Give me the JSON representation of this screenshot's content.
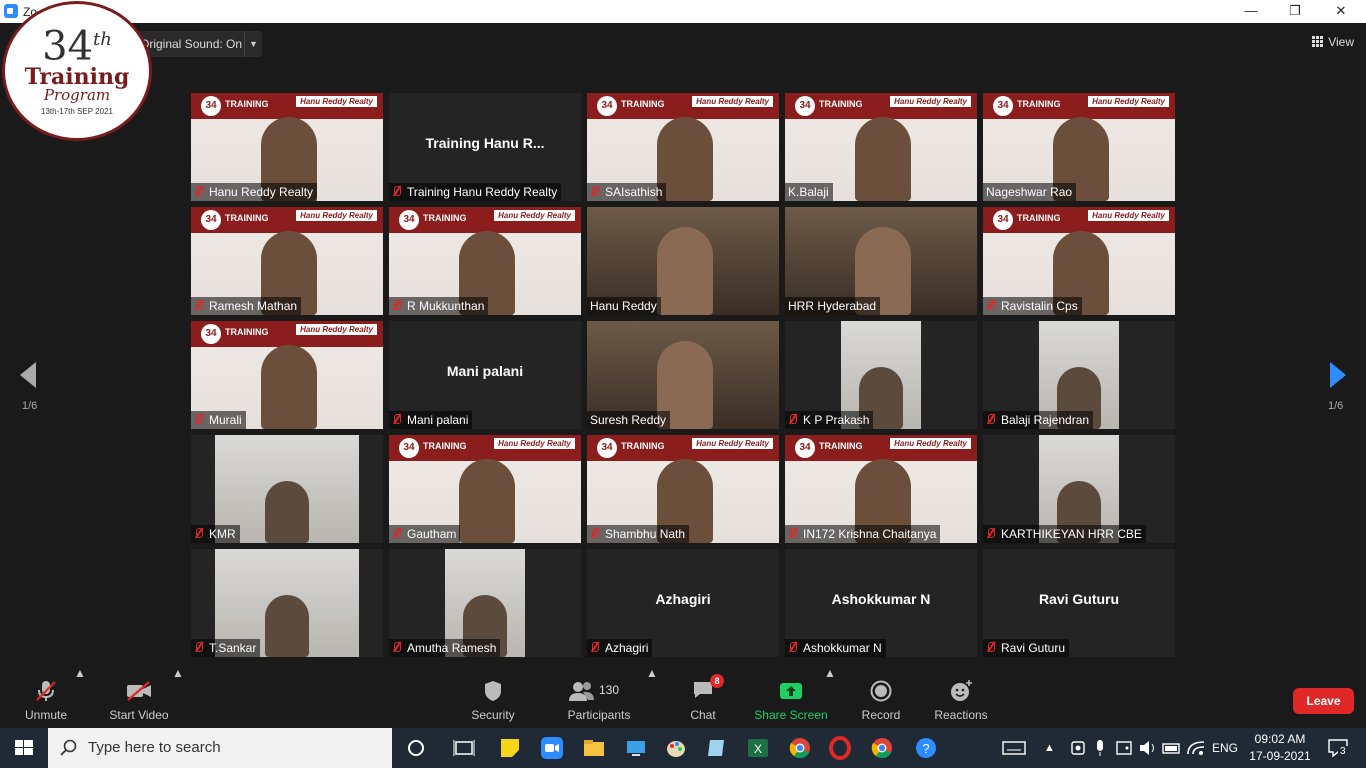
{
  "window": {
    "title": "Zo",
    "minimize": "—",
    "maximize": "❐",
    "close": "✕"
  },
  "topbar": {
    "original_sound": "Original Sound: On",
    "view_label": "View"
  },
  "logo": {
    "number": "34",
    "suffix": "th",
    "line1": "Training",
    "line2": "Program",
    "dates": "13th-17th SEP 2021"
  },
  "tile_brand": "Hanu Reddy Realty",
  "participants": [
    {
      "name": "Hanu Reddy Realty",
      "video": "banner",
      "muted": true
    },
    {
      "name": "Training Hanu Reddy Realty",
      "big": "Training  Hanu R...",
      "video": "none",
      "muted": true
    },
    {
      "name": "SAIsathish",
      "video": "banner",
      "muted": true
    },
    {
      "name": "K.Balaji",
      "video": "banner",
      "muted": false,
      "active": true
    },
    {
      "name": "Nageshwar Rao",
      "video": "banner",
      "muted": false
    },
    {
      "name": "Ramesh Mathan",
      "video": "banner",
      "muted": true
    },
    {
      "name": "R Mukkunthan",
      "video": "banner",
      "muted": true
    },
    {
      "name": "Hanu Reddy",
      "video": "room",
      "muted": false
    },
    {
      "name": "HRR Hyderabad",
      "video": "room",
      "muted": false
    },
    {
      "name": "Ravistalin Cps",
      "video": "banner",
      "muted": true
    },
    {
      "name": "Murali",
      "video": "banner",
      "muted": true
    },
    {
      "name": "Mani palani",
      "big": "Mani palani",
      "video": "none",
      "muted": true
    },
    {
      "name": "Suresh Reddy",
      "video": "room",
      "muted": false
    },
    {
      "name": "K P Prakash",
      "video": "narrow",
      "muted": true
    },
    {
      "name": "Balaji Rajendran",
      "video": "narrow",
      "muted": true
    },
    {
      "name": "KMR",
      "video": "narrow",
      "muted": true
    },
    {
      "name": "Gautham",
      "video": "banner",
      "muted": true
    },
    {
      "name": "Shambhu Nath",
      "video": "banner",
      "muted": true
    },
    {
      "name": "IN172 Krishna Chaitanya",
      "video": "banner",
      "muted": true
    },
    {
      "name": "KARTHIKEYAN HRR CBE",
      "video": "narrow",
      "muted": true
    },
    {
      "name": "T.Sankar",
      "video": "narrow",
      "muted": true
    },
    {
      "name": "Amutha Ramesh",
      "video": "narrow",
      "muted": true
    },
    {
      "name": "Azhagiri",
      "big": "Azhagiri",
      "video": "none",
      "muted": true
    },
    {
      "name": "Ashokkumar N",
      "big": "Ashokkumar N",
      "video": "none",
      "muted": true
    },
    {
      "name": "Ravi Guturu",
      "big": "Ravi Guturu",
      "video": "none",
      "muted": true
    }
  ],
  "pagination": {
    "left": "1/6",
    "right": "1/6"
  },
  "toolbar": {
    "unmute": "Unmute",
    "start_video": "Start Video",
    "security": "Security",
    "participants": "Participants",
    "participants_count": "130",
    "chat": "Chat",
    "chat_badge": "8",
    "share_screen": "Share Screen",
    "record": "Record",
    "reactions": "Reactions",
    "leave": "Leave"
  },
  "taskbar": {
    "search_placeholder": "Type here to search",
    "language": "ENG",
    "time": "09:02 AM",
    "date": "17-09-2021",
    "notifications": "3"
  },
  "colors": {
    "accent_green": "#c8e04a",
    "leave_red": "#e02828",
    "share_green": "#1fcf63",
    "brand_maroon": "#8b1d1d"
  }
}
